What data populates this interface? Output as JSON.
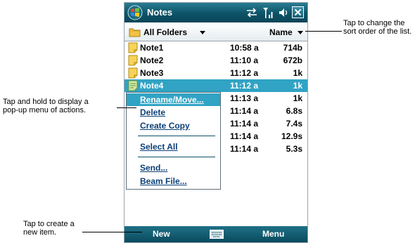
{
  "titlebar": {
    "title": "Notes"
  },
  "folderbar": {
    "folder_label": "All Folders",
    "sort_label": "Name"
  },
  "notes": [
    {
      "name": "Note1",
      "time": "10:58 a",
      "size": "714b",
      "icon": "note-icon"
    },
    {
      "name": "Note2",
      "time": "11:10 a",
      "size": "672b",
      "icon": "note-icon"
    },
    {
      "name": "Note3",
      "time": "11:12 a",
      "size": "1k",
      "icon": "note-icon"
    },
    {
      "name": "Note4",
      "time": "11:12 a",
      "size": "1k",
      "icon": "drawing-note-icon",
      "selected": true
    },
    {
      "name": "",
      "time": "11:13 a",
      "size": "1k"
    },
    {
      "name": "",
      "time": "11:14 a",
      "size": "6.8s"
    },
    {
      "name": "",
      "time": "11:14 a",
      "size": "7.4s"
    },
    {
      "name": "",
      "time": "11:14 a",
      "size": "12.9s"
    },
    {
      "name": "",
      "time": "11:14 a",
      "size": "5.3s"
    }
  ],
  "popup_menu": {
    "items": [
      "Rename/Move...",
      "Delete",
      "Create Copy",
      "Select All",
      "Send...",
      "Beam File..."
    ]
  },
  "softkeys": {
    "left": "New",
    "right": "Menu"
  },
  "callouts": {
    "sort_line1": "Tap to change the",
    "sort_line2": "sort order of the list.",
    "hold_line1": "Tap and hold to display a",
    "hold_line2": "pop-up menu of actions.",
    "new_line1": "Tap to create a",
    "new_line2": "new item."
  },
  "colors": {
    "titlebar": "#0c5267",
    "selection": "#31a3c4",
    "menu_text": "#0b3f78"
  }
}
